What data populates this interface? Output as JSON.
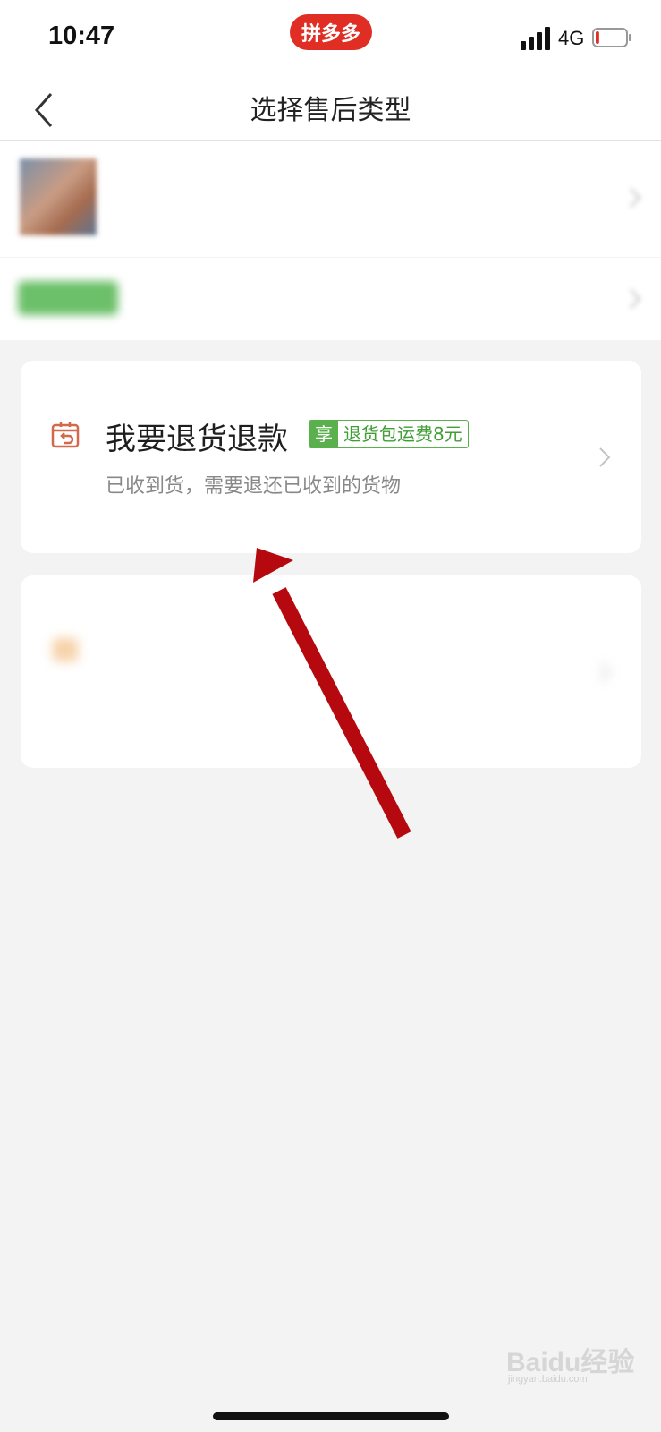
{
  "status_bar": {
    "time": "10:47",
    "brand": "拼多多",
    "network": "4G",
    "brand_color": "#e02e24",
    "battery_level": 0.12
  },
  "nav": {
    "title": "选择售后类型",
    "back_icon": "chevron-left-icon"
  },
  "product": {
    "name": "",
    "status_tag": "",
    "status_text": ""
  },
  "options": [
    {
      "title": "我要退货退款",
      "perk_prefix": "享",
      "perk_text": "退货包运费8元",
      "description": "已收到货，需要退还已收到的货物",
      "icon": "return-box-icon",
      "accent_color": "#d2694a"
    },
    {
      "title": "",
      "description": "",
      "icon": "refund-icon",
      "accent_color": "#f0a35a"
    }
  ],
  "colors": {
    "perk_green": "#59b04c",
    "annotation_arrow": "#b5090f"
  },
  "watermark": {
    "text": "Baidu经验",
    "subtext": "jingyan.baidu.com"
  }
}
